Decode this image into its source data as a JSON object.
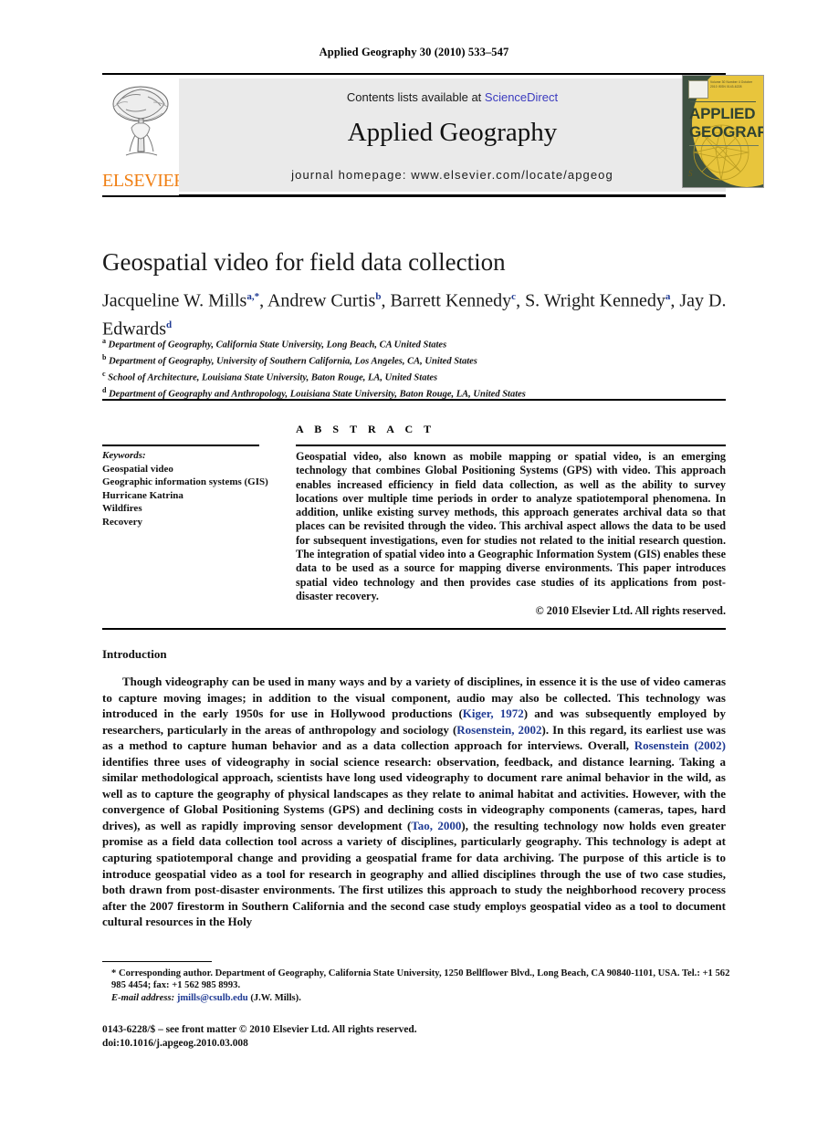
{
  "running_head": "Applied Geography 30 (2010) 533–547",
  "masthead": {
    "contents_prefix": "Contents lists available at ",
    "sciencedirect": "ScienceDirect",
    "journal_name": "Applied Geography",
    "homepage": "journal homepage: www.elsevier.com/locate/apgeog",
    "publisher_word": "ELSEVIER",
    "publisher_logo_color": "#f07f13",
    "band_color": "#eaeaea",
    "link_color": "#3b3bbf"
  },
  "cover": {
    "line1": "APPLIED",
    "line2": "GEOGRAPHY",
    "meta": "Volume 30 Number 4 October 2010 ISSN 0143-6228",
    "background_color": "#3e5141",
    "circle_color": "#e8c53c",
    "text_color": "#2f4233"
  },
  "article": {
    "title": "Geospatial video for field data collection",
    "authors_line1": "Jacqueline W. Mills",
    "authors": [
      {
        "name": "Jacqueline W. Mills",
        "marks": "a,*"
      },
      {
        "name": "Andrew Curtis",
        "marks": "b"
      },
      {
        "name": "Barrett Kennedy",
        "marks": "c"
      },
      {
        "name": "S. Wright Kennedy",
        "marks": "a"
      },
      {
        "name": "Jay D. Edwards",
        "marks": "d"
      }
    ],
    "affiliations": [
      {
        "mark": "a",
        "text": "Department of Geography, California State University, Long Beach, CA United States"
      },
      {
        "mark": "b",
        "text": "Department of Geography, University of Southern California, Los Angeles, CA, United States"
      },
      {
        "mark": "c",
        "text": "School of Architecture, Louisiana State University, Baton Rouge, LA, United States"
      },
      {
        "mark": "d",
        "text": "Department of Geography and Anthropology, Louisiana State University, Baton Rouge, LA, United States"
      }
    ]
  },
  "keywords": {
    "heading": "Keywords:",
    "items": [
      "Geospatial video",
      "Geographic information systems (GIS)",
      "Hurricane Katrina",
      "Wildfires",
      "Recovery"
    ]
  },
  "abstract": {
    "heading": "A B S T R A C T",
    "text": "Geospatial video, also known as mobile mapping or spatial video, is an emerging technology that combines Global Positioning Systems (GPS) with video. This approach enables increased efficiency in field data collection, as well as the ability to survey locations over multiple time periods in order to analyze spatiotemporal phenomena. In addition, unlike existing survey methods, this approach generates archival data so that places can be revisited through the video. This archival aspect allows the data to be used for subsequent investigations, even for studies not related to the initial research question. The integration of spatial video into a Geographic Information System (GIS) enables these data to be used as a source for mapping diverse environments. This paper introduces spatial video technology and then provides case studies of its applications from post-disaster recovery.",
    "copyright": "© 2010 Elsevier Ltd. All rights reserved."
  },
  "introduction": {
    "heading": "Introduction",
    "para_part1": "Though videography can be used in many ways and by a variety of disciplines, in essence it is the use of video cameras to capture moving images; in addition to the visual component, audio may also be collected. This technology was introduced in the early 1950s for use in Hollywood productions (",
    "cite1": "Kiger, 1972",
    "para_part2": ") and was subsequently employed by researchers, particularly in the areas of anthropology and sociology (",
    "cite2": "Rosenstein, 2002",
    "para_part3": "). In this regard, its earliest use was as a method to capture human behavior and as a data collection approach for interviews. Overall, ",
    "cite3": "Rosenstein (2002)",
    "para_part4": " identifies three uses of videography in social science research: observation, feedback, and distance learning. Taking a similar methodological approach, scientists have long used videography to document rare animal behavior in the wild, as well as to capture the geography of physical landscapes as they relate to animal habitat and activities. However, with the convergence of Global Positioning Systems (GPS) and declining costs in videography components (cameras, tapes, hard drives), as well as rapidly improving sensor development (",
    "cite4": "Tao, 2000",
    "para_part5": "), the resulting technology now holds even greater promise as a field data collection tool across a variety of disciplines, particularly geography. This technology is adept at capturing spatiotemporal change and providing a geospatial frame for data archiving. The purpose of this article is to introduce geospatial video as a tool for research in geography and allied disciplines through the use of two case studies, both drawn from post-disaster environments. The first utilizes this approach to study the neighborhood recovery process after the 2007 firestorm in Southern California and the second case study employs geospatial video as a tool to document cultural resources in the Holy"
  },
  "footnote": {
    "corresponding": "* Corresponding author. Department of Geography, California State University, 1250 Bellflower Blvd., Long Beach, CA 90840-1101, USA. Tel.: +1 562 985 4454; fax: +1 562 985 8993.",
    "email_label": "E-mail address:",
    "email": "jmills@csulb.edu",
    "email_owner": "(J.W. Mills).",
    "link_color": "#1f3a93"
  },
  "imprint": {
    "issn_line": "0143-6228/$ – see front matter © 2010 Elsevier Ltd. All rights reserved.",
    "doi_line": "doi:10.1016/j.apgeog.2010.03.008"
  }
}
